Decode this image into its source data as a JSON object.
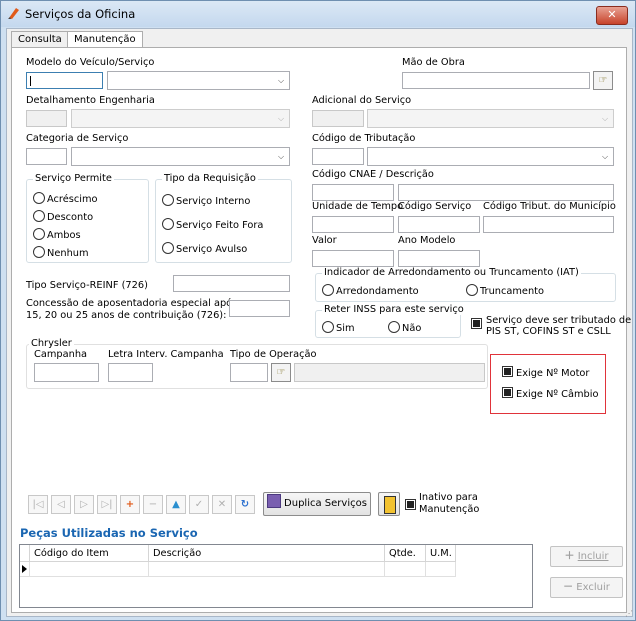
{
  "window": {
    "title": "Serviços da Oficina",
    "close_label": "✕"
  },
  "tabs": [
    {
      "label": "Consulta"
    },
    {
      "label": "Manutenção"
    }
  ],
  "form": {
    "modelo_label": "Modelo do Veículo/Serviço",
    "mao_obra_label": "Mão de Obra",
    "detalhamento_label": "Detalhamento Engenharia",
    "adicional_label": "Adicional do Serviço",
    "categoria_label": "Categoria de Serviço",
    "cod_tributacao_label": "Código de Tributação",
    "cnae_label": "Código CNAE / Descrição",
    "unidade_tempo_label": "Unidade de Tempo",
    "codigo_servico_label": "Código Serviço",
    "codigo_tribut_municipio_label": "Código Tribut. do Município",
    "valor_label": "Valor",
    "ano_modelo_label": "Ano Modelo",
    "tipo_reinf_label": "Tipo Serviço-REINF (726)",
    "concessao_label_1": "Concessão de aposentadoria especial após",
    "concessao_label_2": "15, 20 ou 25 anos de contribuição (726):"
  },
  "servico_permite": {
    "title": "Serviço Permite",
    "options": [
      "Acréscimo",
      "Desconto",
      "Ambos",
      "Nenhum"
    ]
  },
  "tipo_requisicao": {
    "title": "Tipo da Requisição",
    "options": [
      "Serviço Interno",
      "Serviço Feito Fora",
      "Serviço Avulso"
    ]
  },
  "iat": {
    "title": "Indicador de Arredondamento ou Truncamento (IAT)",
    "options": [
      "Arredondamento",
      "Truncamento"
    ]
  },
  "reter_inss": {
    "title": "Reter INSS para este serviço",
    "options": [
      "Sim",
      "Não"
    ]
  },
  "checks": {
    "pis_line1": "Serviço deve ser tributado de",
    "pis_line2": "PIS ST, COFINS ST e CSLL",
    "exige_motor": "Exige Nº Motor",
    "exige_cambio": "Exige Nº Câmbio",
    "inativo_line1": "Inativo para",
    "inativo_line2": "Manutenção"
  },
  "chrysler": {
    "title": "Chrysler",
    "campanha_label": "Campanha",
    "letra_label": "Letra Interv. Campanha",
    "tipo_operacao_label": "Tipo de Operação"
  },
  "toolbar": {
    "nav_icons": [
      "|◁",
      "◁",
      "▷",
      "▷|",
      "+",
      "−",
      "▲",
      "✓",
      "✕",
      "↻"
    ],
    "duplica_label": "Duplica Serviços"
  },
  "pecas": {
    "title": "Peças Utilizadas no Serviço",
    "columns": [
      "Código do Item",
      "Descrição",
      "Qtde.",
      "U.M."
    ],
    "incluir_label": "Incluir",
    "excluir_label": "Excluir"
  },
  "colors": {
    "accent": "#1a66b2",
    "highlight": "#e0333a"
  }
}
